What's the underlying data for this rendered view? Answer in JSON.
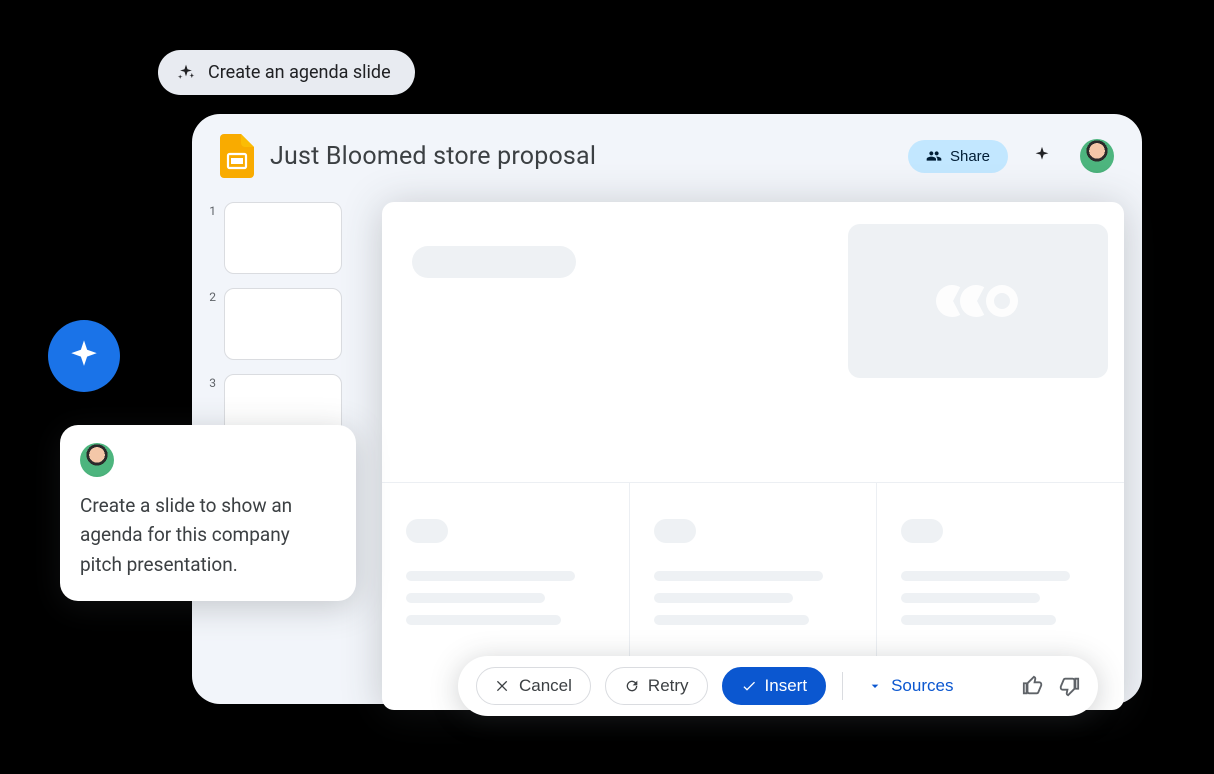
{
  "suggestion": {
    "label": "Create an agenda slide"
  },
  "header": {
    "title": "Just Bloomed store proposal",
    "share_label": "Share"
  },
  "thumbnails": [
    {
      "num": "1"
    },
    {
      "num": "2"
    },
    {
      "num": "3"
    }
  ],
  "prompt": {
    "text": "Create a slide to show an agenda for this company pitch presentation."
  },
  "actions": {
    "cancel": "Cancel",
    "retry": "Retry",
    "insert": "Insert",
    "sources": "Sources"
  }
}
